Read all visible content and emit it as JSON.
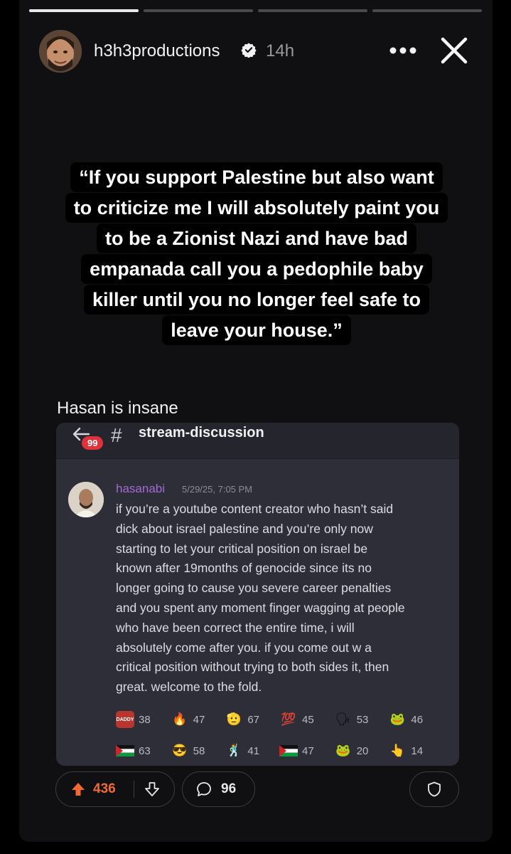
{
  "story": {
    "progress": [
      1.0,
      0.0,
      0.0,
      0.0
    ],
    "username": "h3h3productions",
    "time": "14h",
    "more_icon": "more-dots-icon",
    "close_icon": "close-icon"
  },
  "quote": {
    "lines": [
      "“If you support Palestine but also want",
      "to criticize me I will absolutely paint you",
      "to be a Zionist Nazi and have bad",
      "empanada call you a pedophile baby",
      "killer until you no longer feel safe to",
      "leave your house.”"
    ]
  },
  "caption": "Hasan is insane",
  "discord": {
    "unread_badge": "99",
    "hash": "#",
    "channel": "stream-discussion",
    "author": "hasanabi",
    "timestamp": "5/29/25, 7:05 PM",
    "message_lines": [
      "if you’re a youtube content creator who hasn’t said",
      "dick about israel palestine and you’re only now",
      "starting to let your critical position on israel be",
      "known after 19months of genocide since its no",
      "longer  going to cause you severe career penalties",
      "and you spent any moment finger wagging at people",
      "who have been correct the entire time, i will",
      "absolutely come after you. if you come out w a",
      "critical position without trying to both sides it, then",
      "great. welcome to the fold."
    ],
    "reactions_row1": [
      {
        "icon": "daddy-emote-icon",
        "glyph": "DADDY",
        "count": "38",
        "bg": "#b9362f"
      },
      {
        "icon": "fire-emoji-icon",
        "glyph": "🔥",
        "count": "47",
        "bg": "transparent"
      },
      {
        "icon": "salute-emote-icon",
        "glyph": "🫡",
        "count": "67",
        "bg": "transparent"
      },
      {
        "icon": "hundred-emoji-icon",
        "glyph": "💯",
        "count": "45",
        "bg": "transparent"
      },
      {
        "icon": "speaking-head-emoji-icon",
        "glyph": "🗣",
        "count": "53",
        "bg": "transparent"
      },
      {
        "icon": "pepe-emote-icon",
        "glyph": "🐸",
        "count": "46",
        "bg": "transparent"
      }
    ],
    "reactions_row2": [
      {
        "icon": "palestine-flag-icon",
        "glyph": "",
        "count": "63",
        "bg": "transparent"
      },
      {
        "icon": "peek-emote-icon",
        "glyph": "😎",
        "count": "58",
        "bg": "transparent"
      },
      {
        "icon": "dancing-emote-icon",
        "glyph": "🕺",
        "count": "41",
        "bg": "transparent"
      },
      {
        "icon": "palestine-flag-icon",
        "glyph": "",
        "count": "47",
        "bg": "transparent"
      },
      {
        "icon": "frog-emote-icon",
        "glyph": "🐸",
        "count": "20",
        "bg": "transparent"
      },
      {
        "icon": "pointing-hand-icon",
        "glyph": "👆",
        "count": "14",
        "bg": "transparent"
      }
    ]
  },
  "actions": {
    "upvotes": "436",
    "comments": "96",
    "accent": "#f26a32"
  }
}
